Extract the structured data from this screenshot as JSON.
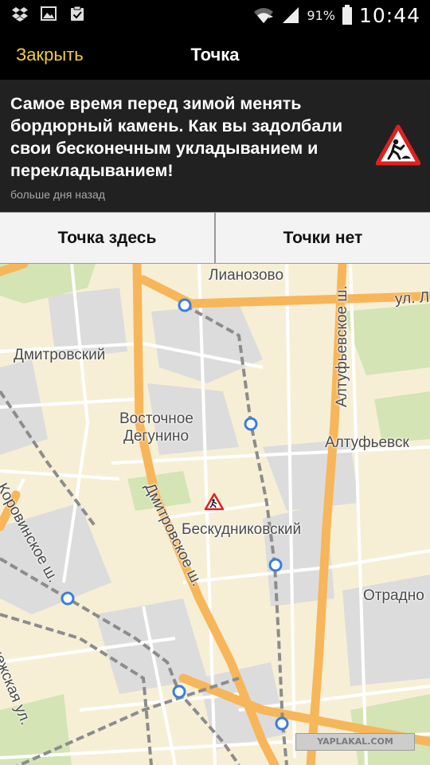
{
  "status_bar": {
    "icons_left": [
      "dropbox-icon",
      "gallery-icon",
      "clipboard-check-icon"
    ],
    "icons_right": [
      "wifi-icon",
      "signal-icon",
      "battery-icon"
    ],
    "battery": "91%",
    "time": "10:44"
  },
  "action_bar": {
    "close_label": "Закрыть",
    "title": "Точка"
  },
  "message": {
    "text": "Самое время перед зимой менять бордюрный камень. Как вы задолбали свои бесконечным укладыванием и перекладыванием!",
    "time_ago": "больше дня назад",
    "icon": "road-works-warning-icon"
  },
  "buttons": {
    "here": "Точка здесь",
    "none": "Точки нет"
  },
  "map": {
    "labels": {
      "lianozovo": "Лианозово",
      "ul": "ул. Л",
      "dmitrovsky": "Дмитровский",
      "altufevskoe_vertical": "Алтуфьевское ш.",
      "vostochnoe_1": "Восточное",
      "vostochnoe_2": "Дегунино",
      "altufevsk": "Алтуфьевск",
      "korovinskoe": "Коровинское ш.",
      "dmitrovskoe": "Дмитровское ш.",
      "beskudnikovsky": "Бескудниковский",
      "otradno": "Отрадно",
      "nezhskaya": "нежская ул."
    },
    "marker_icon": "road-works-marker-icon",
    "station_icon": "railway-station-icon",
    "colors": {
      "background": "#f6efd6",
      "highway": "#f7b65a",
      "road": "#ffffff",
      "railway": "#8c8c8c",
      "industrial": "#dcdcdc",
      "park": "#d4e4b4",
      "station": "#3a7fd9"
    }
  },
  "watermark": "YAPLAKAL.COM"
}
